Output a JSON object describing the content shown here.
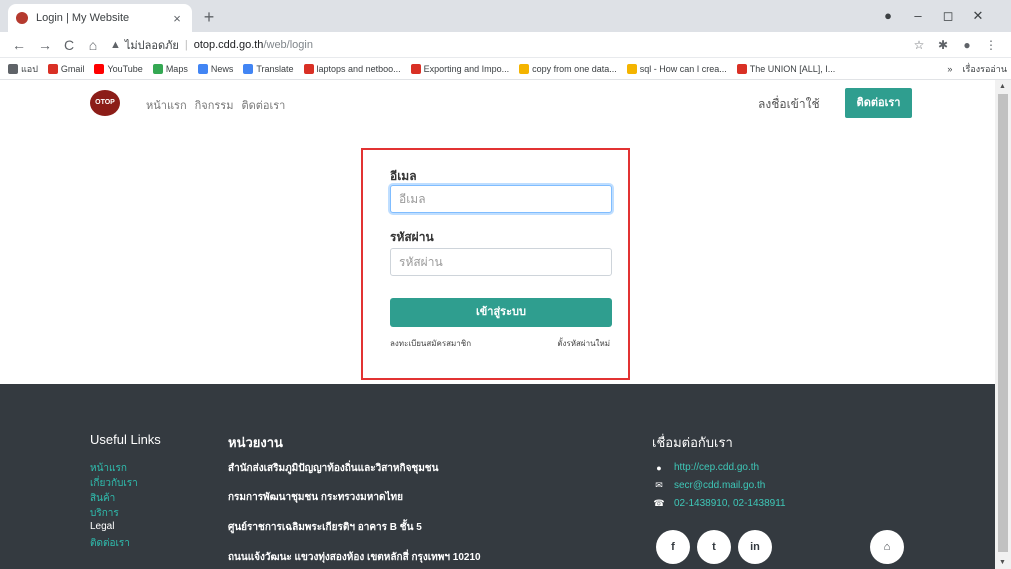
{
  "browser": {
    "tab_title": "Login | My Website",
    "tab_close": "×",
    "new_tab": "+",
    "nav": {
      "back": "←",
      "forward": "→",
      "reload": "C",
      "home": "⌂"
    },
    "insecure_label": "ไม่ปลอดภัย",
    "url_domain": "otop.cdd.go.th",
    "url_path": "/web/login",
    "window_controls": {
      "minimize": "–",
      "maximize": "◻",
      "close": "✕"
    },
    "bookmarks": [
      {
        "label": "แอป",
        "color": "#5f6368"
      },
      {
        "label": "Gmail",
        "color": "#d93025"
      },
      {
        "label": "YouTube",
        "color": "#ff0000"
      },
      {
        "label": "Maps",
        "color": "#34a853"
      },
      {
        "label": "News",
        "color": "#4285f4"
      },
      {
        "label": "Translate",
        "color": "#4285f4"
      },
      {
        "label": "laptops and netboo...",
        "color": "#d93025"
      },
      {
        "label": "Exporting and Impo...",
        "color": "#d93025"
      },
      {
        "label": "copy from one data...",
        "color": "#f4b400"
      },
      {
        "label": "sql - How can I crea...",
        "color": "#f4b400"
      },
      {
        "label": "The UNION [ALL], I...",
        "color": "#d93025"
      }
    ],
    "bookmarks_more": "»",
    "reading_list": "เรื่องรออ่าน"
  },
  "site": {
    "logo_text": "OTOP",
    "nav_links": [
      "หน้าแรก",
      "กิจกรรม",
      "ติดต่อเรา"
    ],
    "signin": "ลงชื่อเข้าใช้",
    "contact_button": "ติดต่อเรา"
  },
  "login": {
    "email_label": "อีเมล",
    "email_placeholder": "อีเมล",
    "password_label": "รหัสผ่าน",
    "password_placeholder": "รหัสผ่าน",
    "submit": "เข้าสู่ระบบ",
    "register_link": "ลงทะเบียนสมัครสมาชิก",
    "reset_link": "ตั้งรหัสผ่านใหม่"
  },
  "footer": {
    "useful_title": "Useful Links",
    "useful_links": [
      "หน้าแรก",
      "เกี่ยวกับเรา",
      "สินค้า",
      "บริการ",
      "Legal",
      "ติดต่อเรา"
    ],
    "agency_title": "หน่วยงาน",
    "agency_lines": [
      "สำนักส่งเสริมภูมิปัญญาท้องถิ่นและวิสาหกิจชุมชน",
      "กรมการพัฒนาชุมชน กระทรวงมหาดไทย",
      "ศูนย์ราชการเฉลิมพระเกียรติฯ อาคาร B ชั้น 5",
      "ถนนแจ้งวัฒนะ แขวงทุ่งสองห้อง เขตหลักสี่ กรุงเทพฯ 10210"
    ],
    "connect_title": "เชื่อมต่อกับเรา",
    "contacts": [
      {
        "icon": "chat-icon",
        "glyph": "●",
        "text": "http://cep.cdd.go.th"
      },
      {
        "icon": "mail-icon",
        "glyph": "✉",
        "text": "secr@cdd.mail.go.th"
      },
      {
        "icon": "phone-icon",
        "glyph": "☎",
        "text": "02-1438910, 02-1438911"
      }
    ],
    "social": [
      {
        "icon": "facebook-icon",
        "glyph": "f"
      },
      {
        "icon": "twitter-icon",
        "glyph": "t"
      },
      {
        "icon": "linkedin-icon",
        "glyph": "in"
      },
      {
        "icon": "home-icon",
        "glyph": "⌂"
      }
    ]
  }
}
